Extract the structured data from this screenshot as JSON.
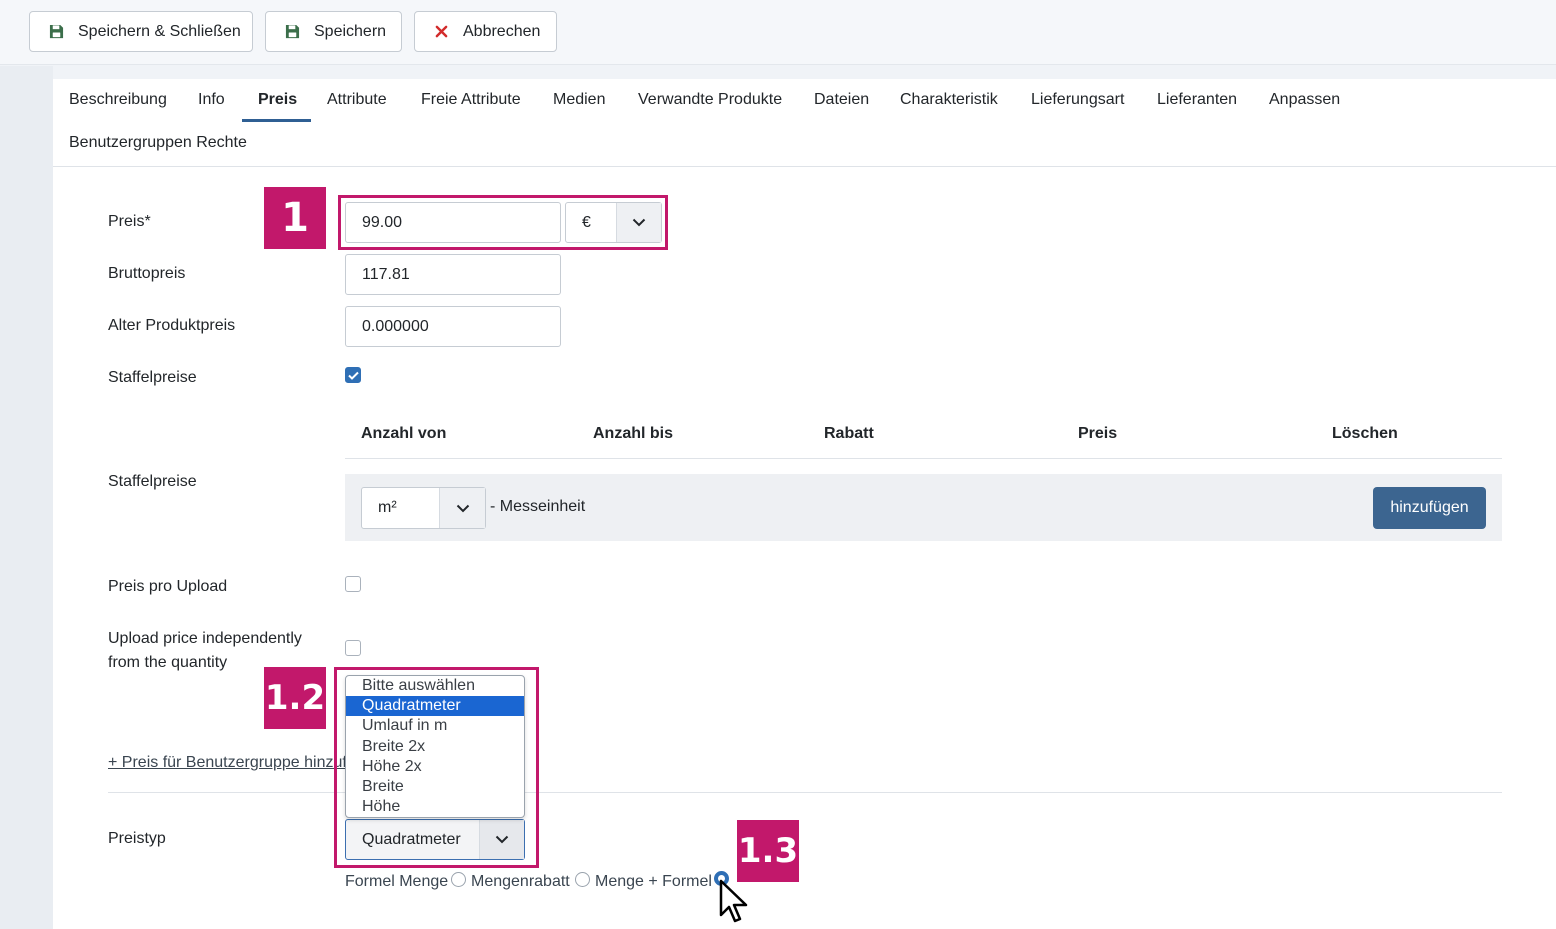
{
  "toolbar": {
    "save_close": "Speichern & Schließen",
    "save": "Speichern",
    "cancel": "Abbrechen"
  },
  "tabs": [
    "Beschreibung",
    "Info",
    "Preis",
    "Attribute",
    "Freie Attribute",
    "Medien",
    "Verwandte Produkte",
    "Dateien",
    "Charakteristik",
    "Lieferungsart",
    "Lieferanten",
    "Anpassen",
    "Benutzergruppen Rechte"
  ],
  "active_tab": "Preis",
  "form": {
    "price_label": "Preis*",
    "price_value": "99.00",
    "currency_value": "€",
    "gross_label": "Bruttopreis",
    "gross_value": "117.81",
    "old_price_label": "Alter Produktpreis",
    "old_price_value": "0.000000",
    "tier_label": "Staffelpreise",
    "tier_checked": true,
    "tier_table_label": "Staffelpreise",
    "tier_headers": [
      "Anzahl von",
      "Anzahl bis",
      "Rabatt",
      "Preis",
      "Löschen"
    ],
    "unit_value": "m²",
    "unit_suffix": "- Messeinheit",
    "add_button": "hinzufügen",
    "per_upload_label": "Preis pro Upload",
    "per_upload_checked": false,
    "upload_indep_label_1": "Upload price independently",
    "upload_indep_label_2": "from the quantity",
    "upload_indep_checked": false,
    "group_price_link": "+ Preis für Benutzergruppe hinzufügen",
    "price_type_label": "Preistyp",
    "price_type_value": "Quadratmeter",
    "price_type_options": [
      "Bitte auswählen",
      "Quadratmeter",
      "Umlauf in m",
      "Breite 2x",
      "Höhe 2x",
      "Breite",
      "Höhe"
    ],
    "price_type_selected_index": 1,
    "radio_labels": [
      "Formel Menge",
      "Mengenrabatt",
      "Menge + Formel"
    ],
    "radio_selected_index": 2
  },
  "markers": [
    "1",
    "1.2",
    "1.3"
  ],
  "colors": {
    "marker": "#c2186b",
    "primary_button": "#3c6590",
    "active_tab_underline": "#2f5f93",
    "dropdown_highlight": "#1a66d2"
  }
}
